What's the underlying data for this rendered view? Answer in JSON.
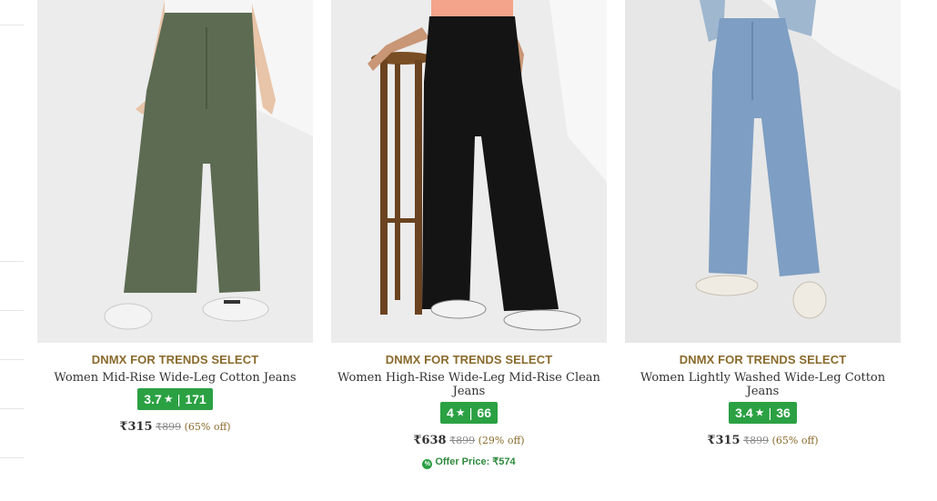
{
  "products": [
    {
      "brand": "DNMX FOR TRENDS SELECT",
      "title": "Women Mid-Rise Wide-Leg Cotton Jeans",
      "rating": "3.7",
      "reviews": "171",
      "price": "₹315",
      "mrp": "₹899",
      "discount": "(65% off)",
      "jeans_color": "#5c6b52"
    },
    {
      "brand": "DNMX FOR TRENDS SELECT",
      "title": "Women High-Rise Wide-Leg Mid-Rise Clean Jeans",
      "rating": "4",
      "reviews": "66",
      "price": "₹638",
      "mrp": "₹899",
      "discount": "(29% off)",
      "offer_price": "Offer Price: ₹574",
      "jeans_color": "#141414"
    },
    {
      "brand": "DNMX FOR TRENDS SELECT",
      "title": "Women Lightly Washed Wide-Leg Cotton Jeans",
      "rating": "3.4",
      "reviews": "36",
      "price": "₹315",
      "mrp": "₹899",
      "discount": "(65% off)",
      "jeans_color": "#7e9ec3"
    }
  ],
  "colors": {
    "brand": "#8a6a2b",
    "rating_badge": "#2ba143",
    "offer": "#2e8a3d"
  },
  "icons": {
    "rating": "star-icon",
    "offer": "offer-tag-icon"
  }
}
